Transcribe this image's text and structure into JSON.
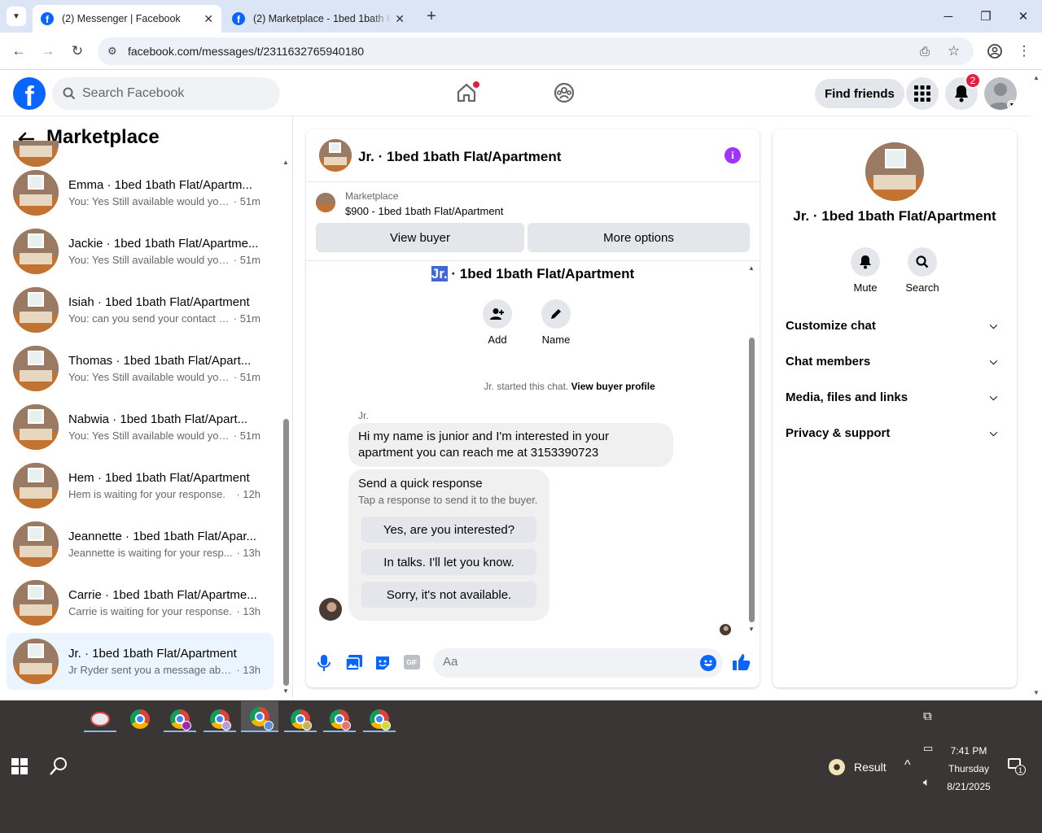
{
  "browser": {
    "tabs": [
      {
        "title": "(2) Messenger | Facebook",
        "active": true
      },
      {
        "title": "(2) Marketplace - 1bed 1bath Fl",
        "active": false
      }
    ],
    "url": "facebook.com/messages/t/2311632765940180",
    "new_tab_icon": "plus-icon"
  },
  "fb_header": {
    "logo": "f",
    "search_placeholder": "Search Facebook",
    "find_friends": "Find friends",
    "notification_count": "2"
  },
  "left": {
    "title": "Marketplace",
    "conversations": [
      {
        "name": "Emma · 1bed 1bath Flat/Apartm...",
        "preview": "You: Yes Still available would you ...",
        "time": "· 51m",
        "selected": false
      },
      {
        "name": "Jackie · 1bed 1bath Flat/Apartme...",
        "preview": "You: Yes Still available would you ...",
        "time": "· 51m",
        "selected": false
      },
      {
        "name": "Isiah · 1bed 1bath Flat/Apartment",
        "preview": "You: can you send your contact n...",
        "time": "· 51m",
        "selected": false
      },
      {
        "name": "Thomas · 1bed 1bath Flat/Apart...",
        "preview": "You: Yes Still available would you ...",
        "time": "· 51m",
        "selected": false
      },
      {
        "name": "Nabwia · 1bed 1bath Flat/Apart...",
        "preview": "You: Yes Still available would you ...",
        "time": "· 51m",
        "selected": false
      },
      {
        "name": "Hem · 1bed 1bath Flat/Apartment",
        "preview": "Hem is waiting for your response.",
        "time": "· 12h",
        "selected": false
      },
      {
        "name": "Jeannette · 1bed 1bath Flat/Apar...",
        "preview": "Jeannette is waiting for your resp...",
        "time": "· 13h",
        "selected": false
      },
      {
        "name": "Carrie · 1bed 1bath Flat/Apartme...",
        "preview": "Carrie is waiting for your response.",
        "time": "· 13h",
        "selected": false
      },
      {
        "name": "Jr. · 1bed 1bath Flat/Apartment",
        "preview": "Jr Ryder sent you a message abou...",
        "time": "· 13h",
        "selected": true
      }
    ]
  },
  "chat": {
    "title": "Jr. · 1bed 1bath Flat/Apartment",
    "listing_source": "Marketplace",
    "listing": "$900 - 1bed 1bath Flat/Apartment",
    "view_buyer": "View buyer",
    "more_options": "More options",
    "intro_name_hl": "Jr.",
    "intro_name_rest": " · 1bed 1bath Flat/Apartment",
    "add_label": "Add",
    "name_label": "Name",
    "started_text": "Jr. started this chat.",
    "view_buyer_profile": "View buyer profile",
    "sender": "Jr.",
    "message_line1": "Hi my name is junior and I'm interested in your",
    "message_line2": "apartment you can reach me at 3153390723",
    "quick_title": "Send a quick response",
    "quick_sub": "Tap a response to send it to the buyer.",
    "quick_responses": [
      "Yes, are you interested?",
      "In talks. I'll let you know.",
      "Sorry, it's not available."
    ],
    "composer_placeholder": "Aa"
  },
  "right": {
    "title": "Jr. · 1bed 1bath Flat/Apartment",
    "mute": "Mute",
    "search": "Search",
    "sections": [
      "Customize chat",
      "Chat members",
      "Media, files and links",
      "Privacy & support"
    ]
  },
  "taskbar": {
    "weather": "Result",
    "time": "7:41 PM",
    "day": "Thursday",
    "date": "8/21/2025",
    "notif_count": "1"
  },
  "colors": {
    "fb_blue": "#0866ff",
    "messenger_purple": "#a033ff",
    "notif_red": "#e41e3f",
    "selected_bg": "#ebf5ff"
  }
}
